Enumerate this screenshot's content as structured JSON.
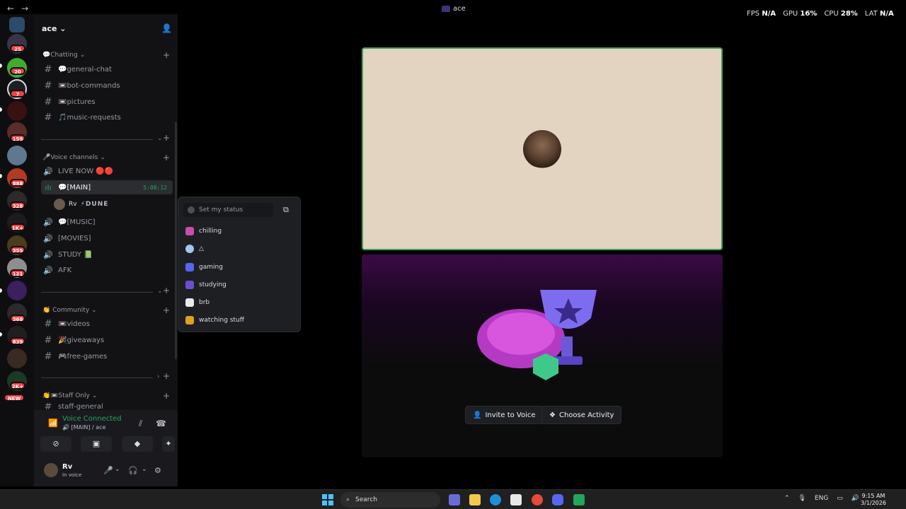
{
  "window": {
    "title": "ace",
    "back": "←",
    "forward": "→"
  },
  "perf": {
    "fps_label": "FPS",
    "fps": "N/A",
    "gpu_label": "GPU",
    "gpu": "16%",
    "cpu_label": "CPU",
    "cpu": "28%",
    "lat_label": "LAT",
    "lat": "N/A"
  },
  "rail": {
    "badges": [
      "25",
      "20",
      "7",
      "159",
      "888",
      "328",
      "1K+",
      "355",
      "121",
      "368",
      "839",
      "2K+",
      "NEW"
    ]
  },
  "server": {
    "name": "ace",
    "caret": "⌄"
  },
  "categories": {
    "chatting": "💬Chatting",
    "voice": "🎤Voice channels",
    "community": "👏 Community",
    "staff": "👏📼Staff Only"
  },
  "channels": {
    "general": "💬general-chat",
    "bot": "📼bot-commands",
    "pictures": "📼pictures",
    "music_req": "🎵music-requests",
    "live_now": "LIVE NOW 🔴🔴",
    "main": "💬[MAIN]",
    "main_timer": "5:08:12",
    "music": "💬[MUSIC]",
    "movies": "[MOVIES]",
    "study": "STUDY 📗",
    "afk": "AFK",
    "videos": "📼videos",
    "giveaways": "🎉giveaways",
    "freegames": "🎮free-games",
    "staff_general": "staff-general"
  },
  "voice_user": {
    "name": "Rv",
    "tag": "⚡DUNE"
  },
  "status_popup": {
    "placeholder": "Set my status",
    "options": [
      "chilling",
      "△",
      "gaming",
      "studying",
      "brb",
      "watching stuff"
    ]
  },
  "voice_panel": {
    "status": "Voice Connected",
    "location": "🔊 [MAIN] / ace"
  },
  "user": {
    "name": "Rv",
    "status": "In voice"
  },
  "activity": {
    "invite": "Invite to Voice",
    "choose": "Choose Activity"
  },
  "taskbar": {
    "search": "Search",
    "lang": "ENG",
    "time": "9:15 AM",
    "date": "3/1/2026"
  },
  "colors": {
    "accent": "#23a55a",
    "tile_border": "#3f9f57",
    "badge": "#f23f43"
  }
}
